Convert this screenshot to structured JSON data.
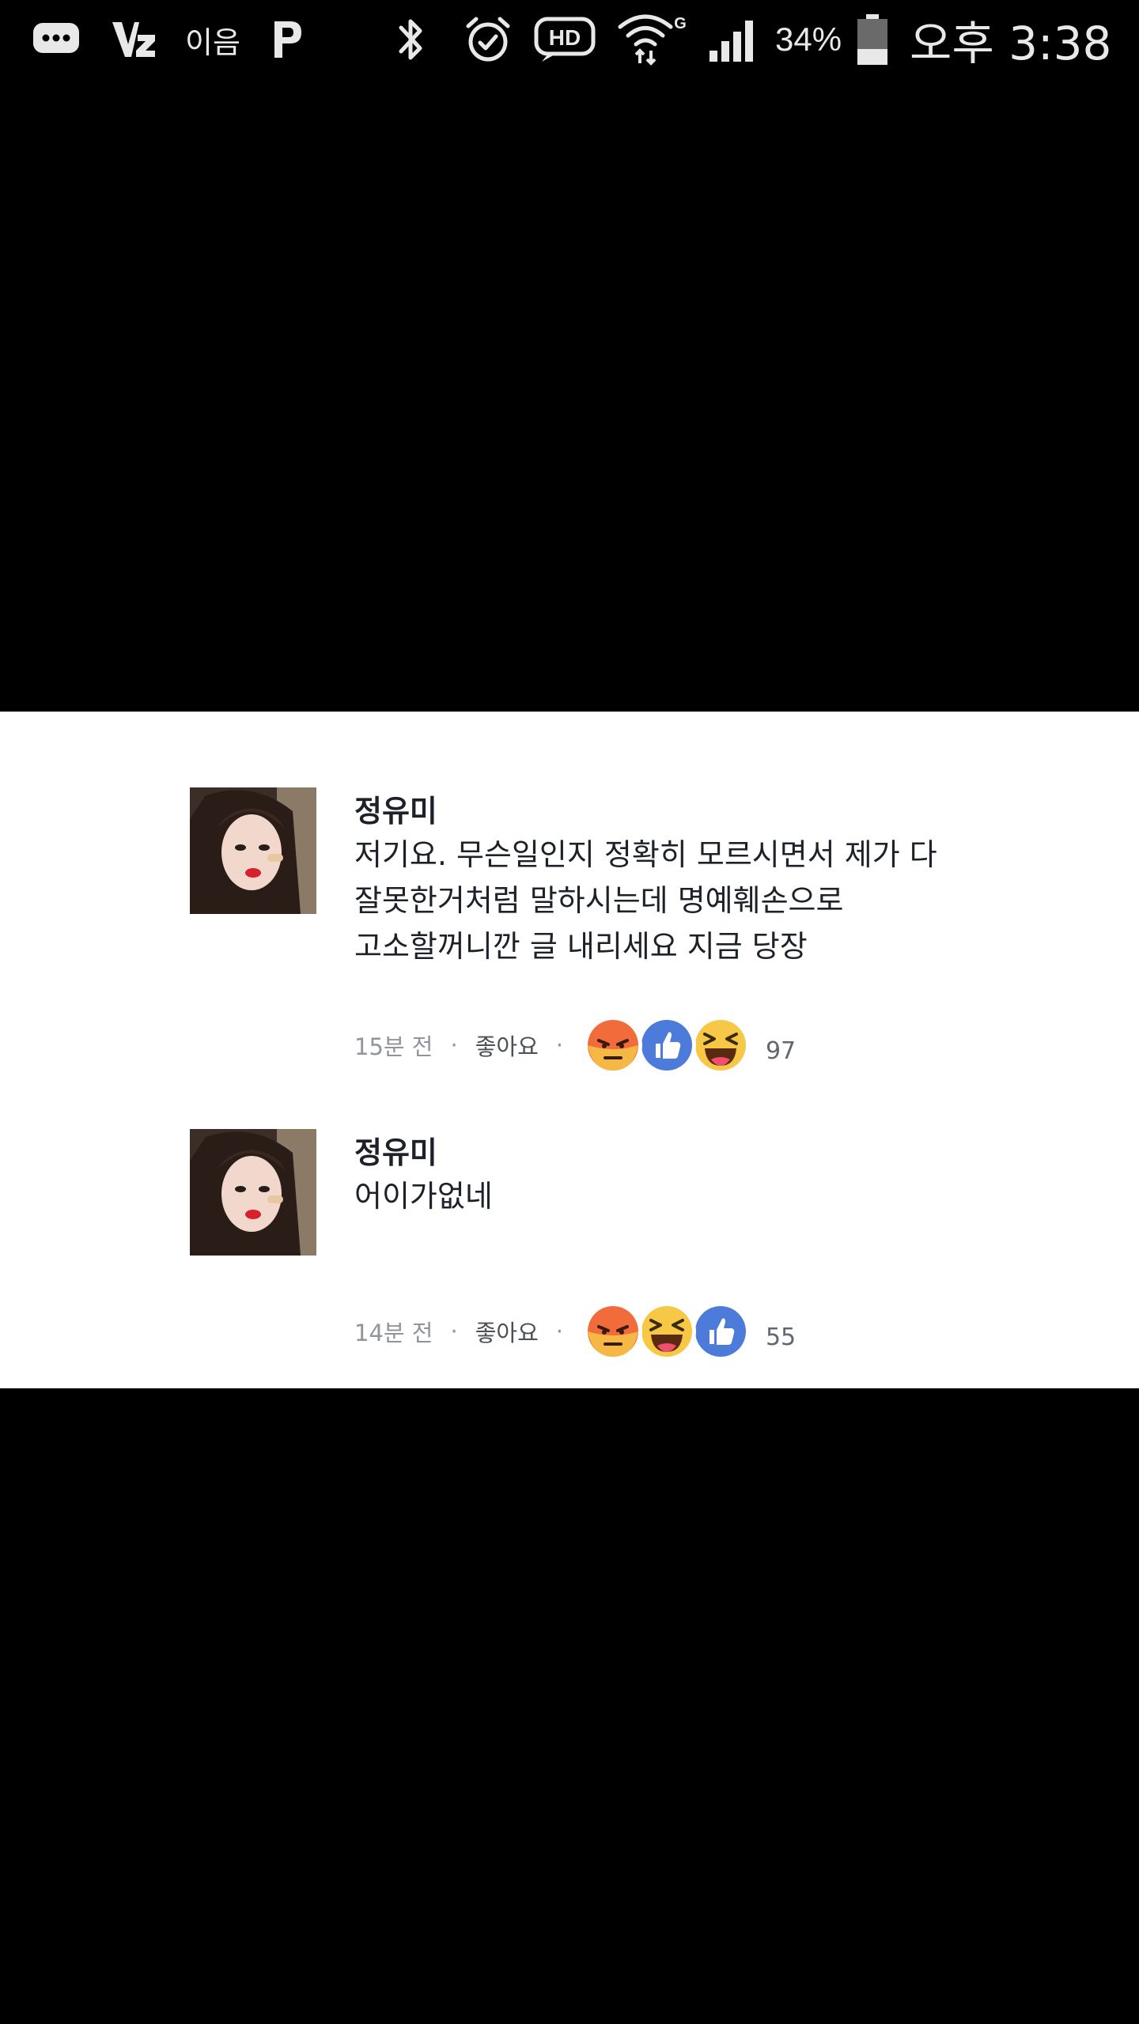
{
  "status_bar": {
    "call_app_label": "이음",
    "battery_percent": "34%",
    "time": "오후 3:38",
    "icons": [
      "message-icon",
      "v-app-icon",
      "p-app-icon",
      "bluetooth-icon",
      "alarm-icon",
      "hd-icon",
      "wifi-icon",
      "signal-icon",
      "battery-icon"
    ]
  },
  "comments": [
    {
      "author": "정유미",
      "lines": [
        "저기요. 무슨일인지 정확히 모르시면서 제가 다",
        "잘못한거처럼 말하시는데 명예훼손으로",
        "고소할꺼니깐 글 내리세요 지금 당장"
      ],
      "time": "15분 전",
      "like_label": "좋아요",
      "separator": "·",
      "reactions": [
        "angry-reaction-icon",
        "like-reaction-icon",
        "haha-reaction-icon"
      ],
      "reaction_count": "97"
    },
    {
      "author": "정유미",
      "lines": [
        "어이가없네"
      ],
      "time": "14분 전",
      "like_label": "좋아요",
      "separator": "·",
      "reactions": [
        "angry-reaction-icon",
        "haha-reaction-icon",
        "like-reaction-icon"
      ],
      "reaction_count": "55"
    }
  ],
  "colors": {
    "background": "#000000",
    "panel": "#ffffff",
    "text": "#1d2129",
    "meta": "#90949c",
    "like_blue": "#4c7bd9",
    "angry": "#f26b3a",
    "haha": "#f7c846"
  }
}
